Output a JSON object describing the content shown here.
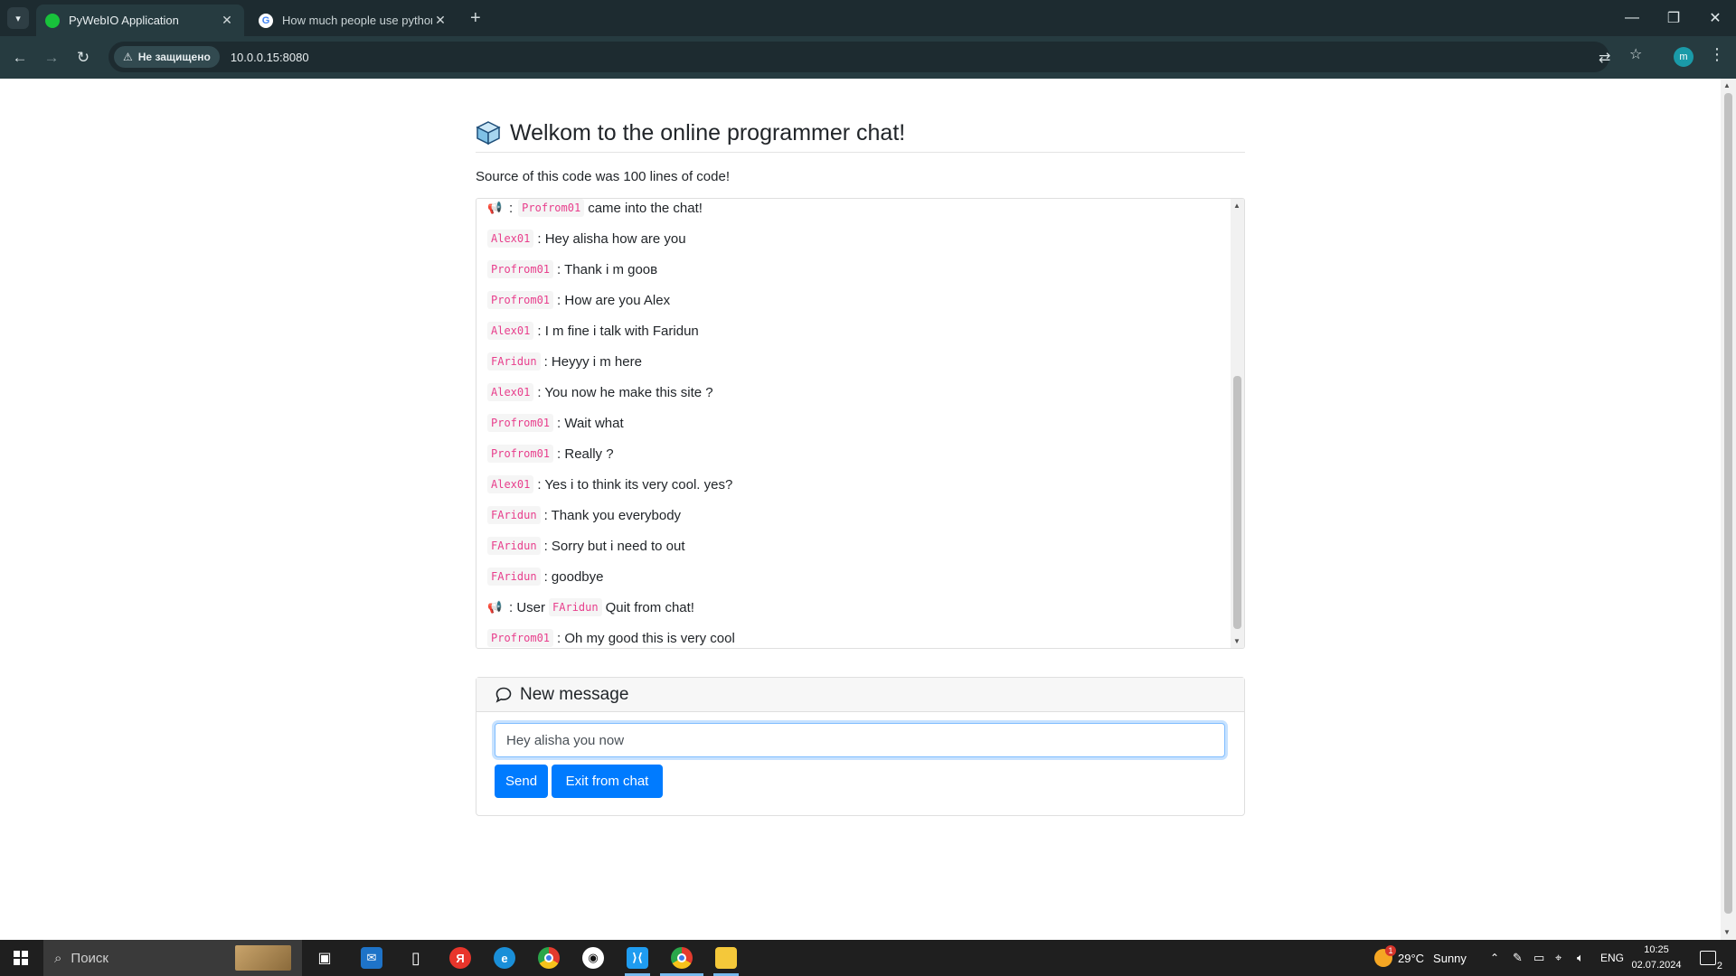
{
  "browser": {
    "tabs": [
      {
        "title": "PyWebIO Application",
        "active": true
      },
      {
        "title": "How much people use python",
        "active": false
      }
    ],
    "security_label": "Не защищено",
    "url": "10.0.0.15:8080",
    "profile_initial": "m",
    "colors": {
      "titlebar": "#1d2b30",
      "toolbar": "#263b40"
    }
  },
  "page": {
    "title": "Welkom to the online programmer chat!",
    "source_note": "Source of this code was 100 lines of code!",
    "messages": [
      {
        "type": "system",
        "user": "Profrom01",
        "text": "came into the chat!"
      },
      {
        "type": "chat",
        "user": "Alex01",
        "text": ": Hey alisha how are you"
      },
      {
        "type": "chat",
        "user": "Profrom01",
        "text": ": Thank i m gooв"
      },
      {
        "type": "chat",
        "user": "Profrom01",
        "text": ": How are you Alex"
      },
      {
        "type": "chat",
        "user": "Alex01",
        "text": ": I m fine i talk with Faridun"
      },
      {
        "type": "chat",
        "user": "FAridun",
        "text": ": Heyyy i m here"
      },
      {
        "type": "chat",
        "user": "Alex01",
        "text": ": You now he make this site ?"
      },
      {
        "type": "chat",
        "user": "Profrom01",
        "text": ": Wait what"
      },
      {
        "type": "chat",
        "user": "Profrom01",
        "text": ": Really ?"
      },
      {
        "type": "chat",
        "user": "Alex01",
        "text": ": Yes i to think its very cool. yes?"
      },
      {
        "type": "chat",
        "user": "FAridun",
        "text": ": Thank you everybody"
      },
      {
        "type": "chat",
        "user": "FAridun",
        "text": ": Sorry but i need to out"
      },
      {
        "type": "chat",
        "user": "FAridun",
        "text": ": goodbye"
      },
      {
        "type": "system_quit",
        "prefix": ": User",
        "user": "FAridun",
        "text": "Quit from chat!"
      },
      {
        "type": "chat",
        "user": "Profrom01",
        "text": ": Oh my good this is very cool"
      }
    ],
    "system_separator": ":",
    "new_message": {
      "header": "New message",
      "input_value": "Hey alisha you now",
      "send_label": "Send",
      "exit_label": "Exit from chat"
    },
    "colors": {
      "primary": "#007bff",
      "username": "#e83e8c"
    }
  },
  "taskbar": {
    "search_placeholder": "Поиск",
    "weather_temp": "29°C",
    "weather_text": "Sunny",
    "weather_badge": "1",
    "language": "ENG",
    "time": "10:25",
    "date": "02.07.2024",
    "notification_count": "2",
    "apps": [
      "task-view-icon",
      "mail-icon",
      "file-icon",
      "yandex-browser-icon",
      "edge-icon",
      "chrome-icon",
      "github-desktop-icon",
      "vscode-icon",
      "chrome-profile-icon",
      "file-explorer-icon"
    ]
  }
}
